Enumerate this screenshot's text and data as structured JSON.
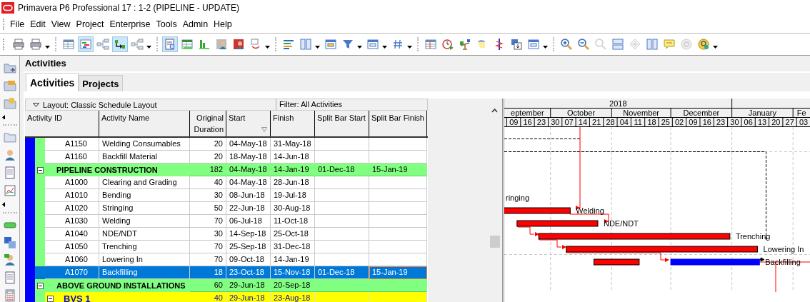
{
  "window": {
    "title": "Primavera P6 Professional 17 : 1-2 (PIPELINE - UPDATE)"
  },
  "menu": [
    "File",
    "Edit",
    "View",
    "Project",
    "Enterprise",
    "Tools",
    "Admin",
    "Help"
  ],
  "panel_title": "Activities",
  "tabs": [
    {
      "label": "Activities",
      "selected": true
    },
    {
      "label": "Projects",
      "selected": false
    }
  ],
  "layout_label": "Layout: Classic Schedule Layout",
  "filter_label": "Filter: All Activities",
  "columns": [
    "Activity ID",
    "Activity Name",
    "Original Duration",
    "Start",
    "Finish",
    "Split Bar Start",
    "Split Bar Finish"
  ],
  "rows": [
    {
      "kind": "activity",
      "selected": false,
      "id": "A1150",
      "name": "Welding Consumables",
      "duration": "20",
      "start": "04-May-18",
      "finish": "31-May-18"
    },
    {
      "kind": "activity",
      "selected": false,
      "id": "A1160",
      "name": "Backfill Material",
      "duration": "20",
      "start": "18-May-18",
      "finish": "14-Jun-18"
    },
    {
      "kind": "wbs",
      "selected": false,
      "expanded": true,
      "name": "PIPELINE CONSTRUCTION",
      "duration": "182",
      "start": "04-May-18",
      "finish": "14-Jan-19",
      "split_start": "01-Dec-18",
      "split_finish": "15-Jan-19"
    },
    {
      "kind": "activity",
      "selected": false,
      "id": "A1000",
      "name": "Clearing and Grading",
      "duration": "40",
      "start": "04-May-18",
      "finish": "28-Jun-18"
    },
    {
      "kind": "activity",
      "selected": false,
      "id": "A1010",
      "name": "Bending",
      "duration": "30",
      "start": "08-Jun-18",
      "finish": "19-Jul-18"
    },
    {
      "kind": "activity",
      "selected": false,
      "id": "A1020",
      "name": "Stringing",
      "duration": "50",
      "start": "22-Jun-18",
      "finish": "30-Aug-18",
      "bar_label": "ringing"
    },
    {
      "kind": "activity",
      "selected": false,
      "id": "A1030",
      "name": "Welding",
      "duration": "70",
      "start": "06-Jul-18",
      "finish": "11-Oct-18",
      "bar_label": "Welding"
    },
    {
      "kind": "activity",
      "selected": false,
      "id": "A1040",
      "name": "NDE/NDT",
      "duration": "30",
      "start": "14-Sep-18",
      "finish": "25-Oct-18",
      "bar_label": "NDE/NDT"
    },
    {
      "kind": "activity",
      "selected": false,
      "id": "A1050",
      "name": "Trenching",
      "duration": "70",
      "start": "25-Sep-18",
      "finish": "31-Dec-18",
      "bar_label": "Trenching"
    },
    {
      "kind": "activity",
      "selected": false,
      "id": "A1060",
      "name": "Lowering In",
      "duration": "70",
      "start": "09-Oct-18",
      "finish": "14-Jan-19",
      "bar_label": "Lowering In"
    },
    {
      "kind": "activity",
      "selected": true,
      "id": "A1070",
      "name": "Backfilling",
      "duration": "18",
      "start": "23-Oct-18",
      "finish": "15-Nov-18",
      "split_start": "01-Dec-18",
      "split_finish": "15-Jan-19",
      "bar_label": "Backfilling"
    },
    {
      "kind": "wbs",
      "selected": false,
      "expanded": true,
      "name": "ABOVE GROUND INSTALLATIONS",
      "duration": "60",
      "start": "29-Jun-18",
      "finish": "20-Sep-18"
    },
    {
      "kind": "subwbs",
      "selected": false,
      "expanded": true,
      "name": "BVS 1",
      "duration": "40",
      "start": "29-Jun-18",
      "finish": "23-Aug-18"
    }
  ],
  "timescale": {
    "year": "2018",
    "months": [
      "eptember",
      "October",
      "November",
      "December",
      "January",
      "Fe"
    ],
    "weeks": [
      "09",
      "16",
      "23",
      "30",
      "07",
      "14",
      "21",
      "28",
      "04",
      "11",
      "18",
      "25",
      "02",
      "09",
      "16",
      "23",
      "30",
      "06",
      "13",
      "20",
      "27",
      "03"
    ]
  }
}
